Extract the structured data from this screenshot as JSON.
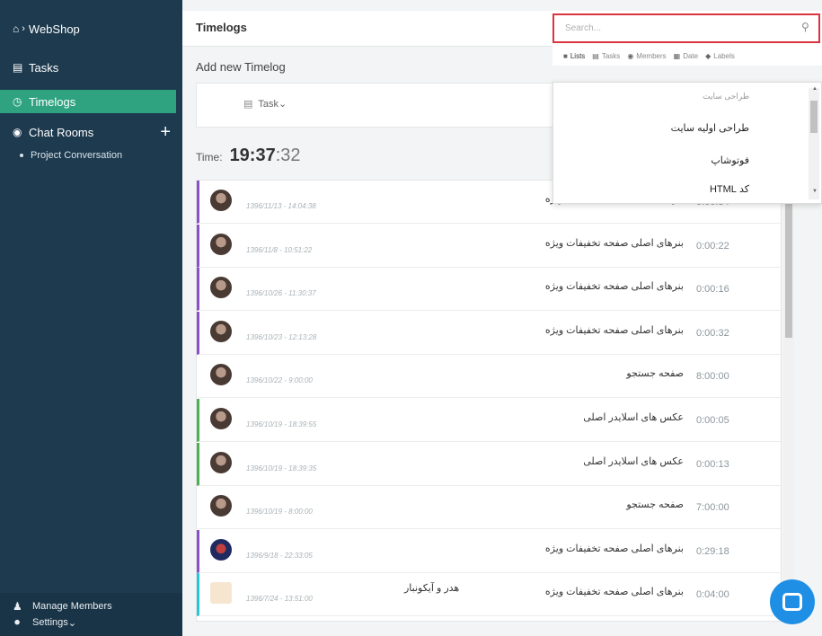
{
  "sidebar": {
    "brand": "WebShop",
    "items": [
      {
        "label": "Tasks",
        "icon": "tasks-icon"
      },
      {
        "label": "Timelogs",
        "icon": "clock-icon"
      },
      {
        "label": "Chat Rooms",
        "icon": "chat-icon"
      }
    ],
    "chat_sub": "Project Conversation",
    "bottom": {
      "members": "Manage Members",
      "settings": "Settings"
    }
  },
  "header": {
    "title": "Timelogs"
  },
  "add_timelog": {
    "title": "Add new Timelog",
    "task_label": "Task"
  },
  "timer": {
    "label": "Time:",
    "hours_minutes": "19:37",
    "seconds": ":32"
  },
  "search": {
    "placeholder": "Search...",
    "filters": [
      "Lists",
      "Tasks",
      "Members",
      "Date",
      "Labels"
    ],
    "results": [
      "طراحی سایت",
      "طراحی اولیه سایت",
      "فوتوشاپ",
      "کد HTML"
    ]
  },
  "timelogs": [
    {
      "date": "1396/11/13 - 14:04:38",
      "task": "بنرهای اصلی صفحه تخفیفات ویژه",
      "label": "",
      "duration": "0:06:34",
      "color": "#8a4fc9"
    },
    {
      "date": "1396/11/8 - 10:51:22",
      "task": "بنرهای اصلی صفحه تخفیفات ویژه",
      "label": "",
      "duration": "0:00:22",
      "color": "#8a4fc9"
    },
    {
      "date": "1396/10/26 - 11:30:37",
      "task": "بنرهای اصلی صفحه تخفیفات ویژه",
      "label": "",
      "duration": "0:00:16",
      "color": "#8a4fc9"
    },
    {
      "date": "1396/10/23 - 12:13:28",
      "task": "بنرهای اصلی صفحه تخفیفات ویژه",
      "label": "",
      "duration": "0:00:32",
      "color": "#8a4fc9"
    },
    {
      "date": "1396/10/22 - 9:00:00",
      "task": "صفحه جستجو",
      "label": "",
      "duration": "8:00:00",
      "color": "transparent"
    },
    {
      "date": "1396/10/19 - 18:39:55",
      "task": "عکس های اسلایدر اصلی",
      "label": "",
      "duration": "0:00:05",
      "color": "#4caf50"
    },
    {
      "date": "1396/10/19 - 18:39:35",
      "task": "عکس های اسلایدر اصلی",
      "label": "",
      "duration": "0:00:13",
      "color": "#4caf50"
    },
    {
      "date": "1396/10/19 - 8:00:00",
      "task": "صفحه جستجو",
      "label": "",
      "duration": "7:00:00",
      "color": "transparent"
    },
    {
      "date": "1396/9/18 - 22:33:05",
      "task": "بنرهای اصلی صفحه تخفیفات ویژه",
      "label": "",
      "duration": "0:29:18",
      "color": "#8a4fc9"
    },
    {
      "date": "1396/7/24 - 13:51:00",
      "task": "بنرهای اصلی صفحه تخفیفات ویژه",
      "label": "هدر و آیکونبار",
      "duration": "0:04:00",
      "color": "#26c6da"
    }
  ]
}
